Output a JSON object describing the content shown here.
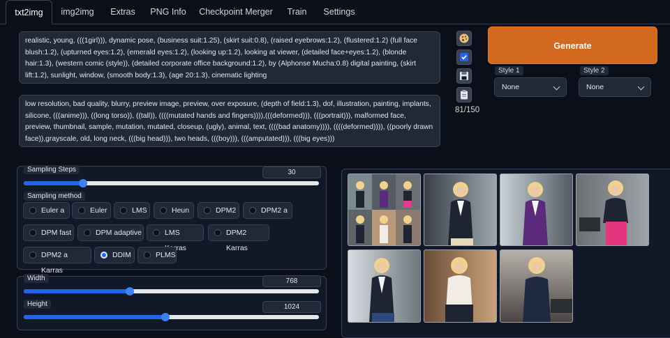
{
  "tabs": [
    {
      "label": "txt2img",
      "active": true
    },
    {
      "label": "img2img"
    },
    {
      "label": "Extras"
    },
    {
      "label": "PNG Info"
    },
    {
      "label": "Checkpoint Merger"
    },
    {
      "label": "Train"
    },
    {
      "label": "Settings"
    }
  ],
  "prompt": {
    "positive": "realistic, young, (((1girl))), dynamic pose, (business suit:1.25), (skirt suit:0.8), (raised eyebrows:1.2), (flustered:1.2) (full face blush:1.2), (upturned eyes:1.2), (emerald eyes:1.2), (looking up:1.2), looking at viewer, (detailed face+eyes:1.2), (blonde hair:1.3), (western comic (style)), (detailed corporate office background:1.2), by (Alphonse Mucha:0.8) digital painting, (skirt lift:1.2), sunlight, window, (smooth body:1.3), (age 20:1.3), cinematic lighting",
    "negative": "low resolution, bad quality, blurry, preview image, preview, over exposure, (depth of field:1.3), dof, illustration, painting, implants, silicone, (((anime))), ((long torso)), ((tall)), ((((mutated hands and fingers)))),(((deformed))), (((portrait))), malformed face, preview, thumbnail, sample, mutation, mutated, closeup, (ugly), animal, text, ((((bad anatomy)))), ((((deformed)))), ((poorly drawn face)),grayscale, old, long neck, (((big head))), two heads, (((boy))), (((amputated))), (((big eyes)))",
    "token_counter": "81/150"
  },
  "tools": [
    "palette-icon",
    "checkbox-icon",
    "save-icon",
    "clipboard-icon"
  ],
  "generate_label": "Generate",
  "styles": [
    {
      "label": "Style 1",
      "value": "None"
    },
    {
      "label": "Style 2",
      "value": "None"
    }
  ],
  "sampling_steps": {
    "label": "Sampling Steps",
    "value": "30",
    "fraction": 0.2
  },
  "sampling_method": {
    "label": "Sampling method",
    "options": [
      "Euler a",
      "Euler",
      "LMS",
      "Heun",
      "DPM2",
      "DPM2 a",
      "DPM fast",
      "DPM adaptive",
      "LMS Karras",
      "DPM2 Karras",
      "DPM2 a Karras",
      "DDIM",
      "PLMS"
    ],
    "selected": "DDIM"
  },
  "width": {
    "label": "Width",
    "value": "768",
    "fraction": 0.36
  },
  "height": {
    "label": "Height",
    "value": "1024",
    "fraction": 0.48
  },
  "colors": {
    "accent": "#2563eb",
    "generate": "#d2691e",
    "background": "#0b0f19",
    "panel": "#111827"
  }
}
